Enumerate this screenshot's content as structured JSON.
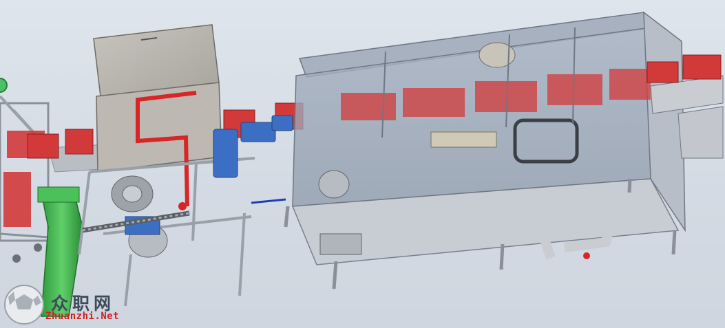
{
  "watermark": {
    "site_name": "众职网",
    "url": "Zhuanzhi.Net",
    "logo_icon": "soccer-ball-globe-icon"
  },
  "colors": {
    "frame": "#c9cdd3",
    "frame_dark": "#8b9098",
    "glass": "#9aa7b8",
    "crate_red": "#d23a3a",
    "motor_blue": "#3c6fc4",
    "hose_green": "#3bb04a",
    "pipe_red": "#d82525",
    "background": "#d8dee6"
  }
}
